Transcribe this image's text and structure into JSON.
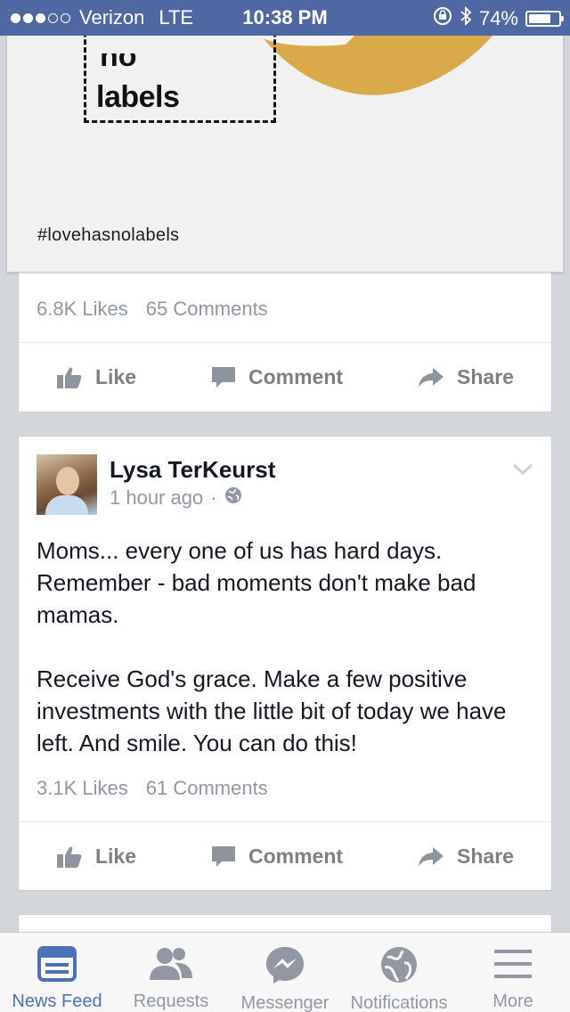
{
  "status_bar": {
    "carrier": "Verizon",
    "network": "LTE",
    "time": "10:38 PM",
    "battery": "74%",
    "battery_level": 0.74,
    "signal_bars": 3
  },
  "shared_post": {
    "image_label_top": "no",
    "image_label": "labels",
    "hashtag": "#lovehasnolabels",
    "likes": "6.8K Likes",
    "comments": "65 Comments",
    "actions": {
      "like": "Like",
      "comment": "Comment",
      "share": "Share"
    }
  },
  "post": {
    "author": "Lysa TerKeurst",
    "time": "1 hour ago",
    "separator": "·",
    "text": "Moms... every one of us has hard days. Remember - bad moments don't make bad mamas.\n\nReceive God's grace. Make a few positive investments with the little bit of today we have left. And smile. You can do this!",
    "likes": "3.1K Likes",
    "comments": "61 Comments",
    "actions": {
      "like": "Like",
      "comment": "Comment",
      "share": "Share"
    }
  },
  "tab_bar": {
    "items": [
      {
        "label": "News Feed",
        "icon": "news-feed-icon",
        "active": true
      },
      {
        "label": "Requests",
        "icon": "requests-icon",
        "active": false
      },
      {
        "label": "Messenger",
        "icon": "messenger-icon",
        "active": false
      },
      {
        "label": "Notifications",
        "icon": "notifications-icon",
        "active": false
      },
      {
        "label": "More",
        "icon": "more-icon",
        "active": false
      }
    ]
  },
  "colors": {
    "status_bar": "#4e69a2",
    "feed_background": "#d3d6db",
    "active_tab": "#4c70ba",
    "muted_text": "#9197a3",
    "image_accent": "#d9a94a"
  }
}
